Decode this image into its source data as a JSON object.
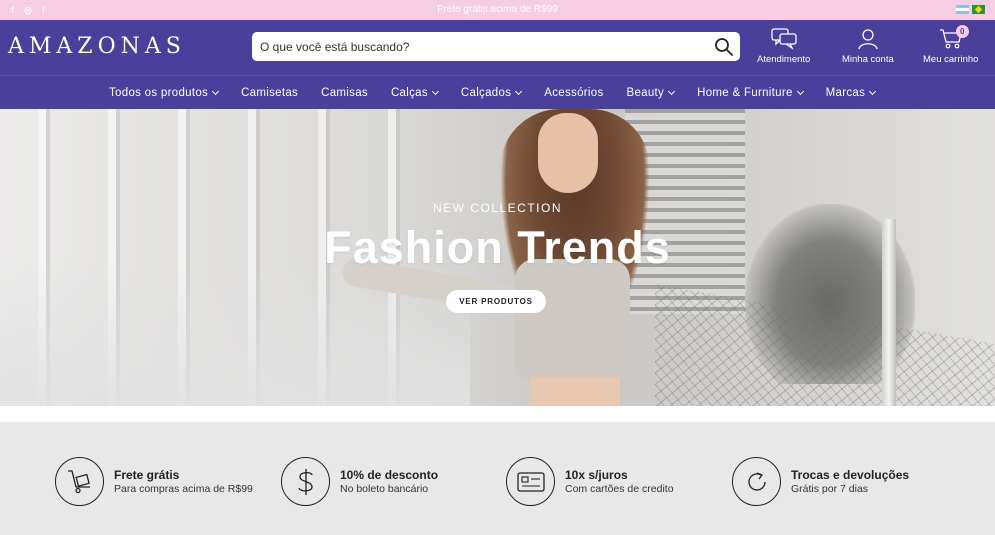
{
  "topbar": {
    "promo": "Frete grátis acima de R$99",
    "socials": [
      "f",
      "◎",
      "t"
    ]
  },
  "header": {
    "logo": "AMAZONAS",
    "search_placeholder": "O que você está buscando?",
    "atendimento": "Atendimento",
    "minha_conta": "Minha conta",
    "meu_carrinho": "Meu carrinho",
    "cart_count": "0"
  },
  "nav": {
    "items": [
      {
        "label": "Todos os produtos"
      },
      {
        "label": "Camisetas"
      },
      {
        "label": "Camisas"
      },
      {
        "label": "Calças"
      },
      {
        "label": "Calçados"
      },
      {
        "label": "Acessórios"
      },
      {
        "label": "Beauty"
      },
      {
        "label": "Home & Furniture"
      },
      {
        "label": "Marcas"
      }
    ]
  },
  "hero": {
    "kicker": "NEW COLLECTION",
    "title": "Fashion Trends",
    "cta": "VER PRODUTOS"
  },
  "benefits": [
    {
      "title": "Frete grátis",
      "subtitle": "Para compras acima de R$99"
    },
    {
      "title": "10% de desconto",
      "subtitle": "No boleto bancário"
    },
    {
      "title": "10x s/juros",
      "subtitle": "Com cartões de credito"
    },
    {
      "title": "Trocas e devoluções",
      "subtitle": "Grátis por 7 dias"
    }
  ],
  "colors": {
    "topbar": "#f7cde3",
    "header": "#4a3f9a",
    "benefits_bg": "#e8e8e8"
  }
}
